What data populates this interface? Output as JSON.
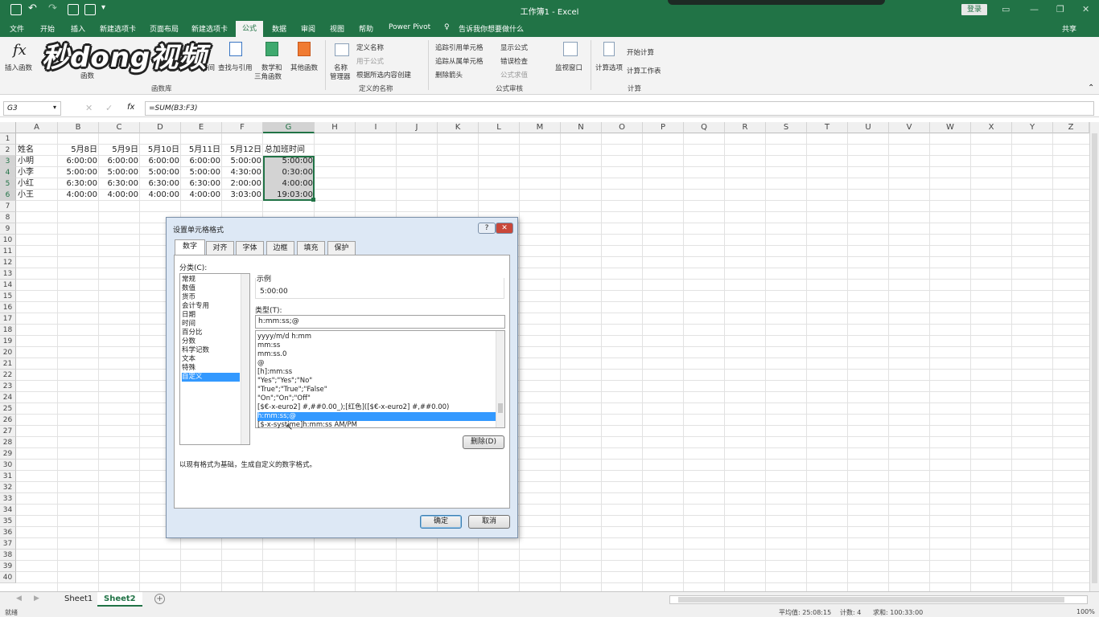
{
  "app": {
    "title": "工作簿1 - Excel",
    "login": "登录",
    "watermark": "秒dong视频"
  },
  "tabs": [
    "文件",
    "开始",
    "插入",
    "新建选项卡",
    "页面布局",
    "新建选项卡",
    "公式",
    "数据",
    "审阅",
    "视图",
    "帮助",
    "Power Pivot",
    "告诉我你想要做什么",
    "共享"
  ],
  "ribbon": {
    "insert_fn": "插入函数",
    "fn_lib": "函数库",
    "fn": "函数",
    "time": "时间",
    "lookup": "查找与引用",
    "math1": "数学和",
    "math2": "三角函数",
    "more": "其他函数",
    "name_mgr1": "名称",
    "name_mgr2": "管理器",
    "define_name": "定义名称",
    "use_in": "用于公式",
    "create_sel": "根据所选内容创建",
    "defined_names": "定义的名称",
    "trace_prec": "追踪引用单元格",
    "trace_dep": "追踪从属单元格",
    "remove_arrows": "删除箭头",
    "show_formulas": "显示公式",
    "error_check": "错误检查",
    "eval_formula": "公式求值",
    "audit": "公式审核",
    "watch": "监视窗口",
    "calc_opts": "计算选项",
    "calc_now": "开始计算",
    "calc_sheet": "计算工作表",
    "calc": "计算"
  },
  "formula_bar": {
    "name_box": "G3",
    "fx": "fx",
    "formula": "=SUM(B3:F3)"
  },
  "columns": [
    "A",
    "B",
    "C",
    "D",
    "E",
    "F",
    "G",
    "H",
    "I",
    "J",
    "K",
    "L",
    "M",
    "N",
    "O",
    "P",
    "Q",
    "R",
    "S",
    "T",
    "U",
    "V",
    "W",
    "X",
    "Y",
    "Z"
  ],
  "rows": [
    "1",
    "2",
    "3",
    "4",
    "5",
    "6",
    "7",
    "8",
    "9",
    "10",
    "11",
    "12",
    "13",
    "14",
    "15",
    "16",
    "17",
    "18",
    "19",
    "20",
    "21",
    "22",
    "23",
    "24",
    "25",
    "26",
    "27",
    "28",
    "29",
    "30",
    "31",
    "32",
    "33",
    "34",
    "35",
    "36",
    "37",
    "38",
    "39",
    "40"
  ],
  "table": {
    "headers": [
      "姓名",
      "5月8日",
      "5月9日",
      "5月10日",
      "5月11日",
      "5月12日",
      "总加班时间"
    ],
    "data": [
      [
        "小明",
        "6:00:00",
        "6:00:00",
        "6:00:00",
        "6:00:00",
        "5:00:00",
        "5:00:00"
      ],
      [
        "小李",
        "5:00:00",
        "5:00:00",
        "5:00:00",
        "5:00:00",
        "4:30:00",
        "0:30:00"
      ],
      [
        "小红",
        "6:30:00",
        "6:30:00",
        "6:30:00",
        "6:30:00",
        "2:00:00",
        "4:00:00"
      ],
      [
        "小王",
        "4:00:00",
        "4:00:00",
        "4:00:00",
        "4:00:00",
        "3:03:00",
        "19:03:00"
      ]
    ]
  },
  "sheets": [
    "Sheet1",
    "Sheet2"
  ],
  "status": {
    "ready": "就绪",
    "average": "平均值: 25:08:15",
    "count": "计数: 4",
    "sum": "求和: 100:33:00",
    "zoom": "100%"
  },
  "dialog": {
    "title": "设置单元格格式",
    "tabs": [
      "数字",
      "对齐",
      "字体",
      "边框",
      "填充",
      "保护"
    ],
    "category_label": "分类(C):",
    "categories": [
      "常规",
      "数值",
      "货币",
      "会计专用",
      "日期",
      "时间",
      "百分比",
      "分数",
      "科学记数",
      "文本",
      "特殊",
      "自定义"
    ],
    "sample_label": "示例",
    "sample": "5:00:00",
    "type_label": "类型(T):",
    "type_value": "h:mm:ss;@",
    "types": [
      "yyyy/m/d h:mm",
      "mm:ss",
      "mm:ss.0",
      "@",
      "[h]:mm:ss",
      "\"Yes\";\"Yes\";\"No\"",
      "\"True\";\"True\";\"False\"",
      "\"On\";\"On\";\"Off\"",
      "[$€-x-euro2] #,##0.00_);[红色]([$€-x-euro2] #,##0.00)",
      "h:mm:ss;@",
      "[$-x-systime]h:mm:ss AM/PM"
    ],
    "delete_btn": "删除(D)",
    "description": "以现有格式为基础，生成自定义的数字格式。",
    "ok": "确定",
    "cancel": "取消",
    "help": "?",
    "close": "✕"
  }
}
